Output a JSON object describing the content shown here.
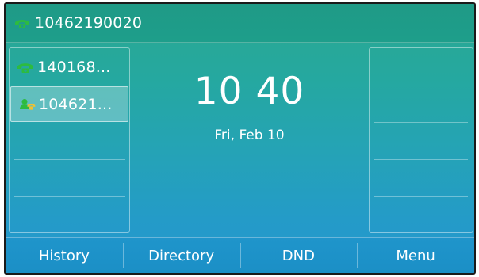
{
  "status_bar": {
    "account_number": "10462190020",
    "account_icon": "phone-handset-icon"
  },
  "left_lines": [
    {
      "label": "140168...",
      "icon": "phone-handset-icon",
      "selected": false
    },
    {
      "label": "104621...",
      "icon": "contact-phone-icon",
      "selected": true
    }
  ],
  "clock": {
    "time": "10 40",
    "date": "Fri, Feb 10"
  },
  "softkeys": [
    {
      "label": "History"
    },
    {
      "label": "Directory"
    },
    {
      "label": "DND"
    },
    {
      "label": "Menu"
    }
  ],
  "colors": {
    "icon_green": "#2dbb3f",
    "text": "#ffffff",
    "softkey_bar": "#1b8fc6"
  }
}
